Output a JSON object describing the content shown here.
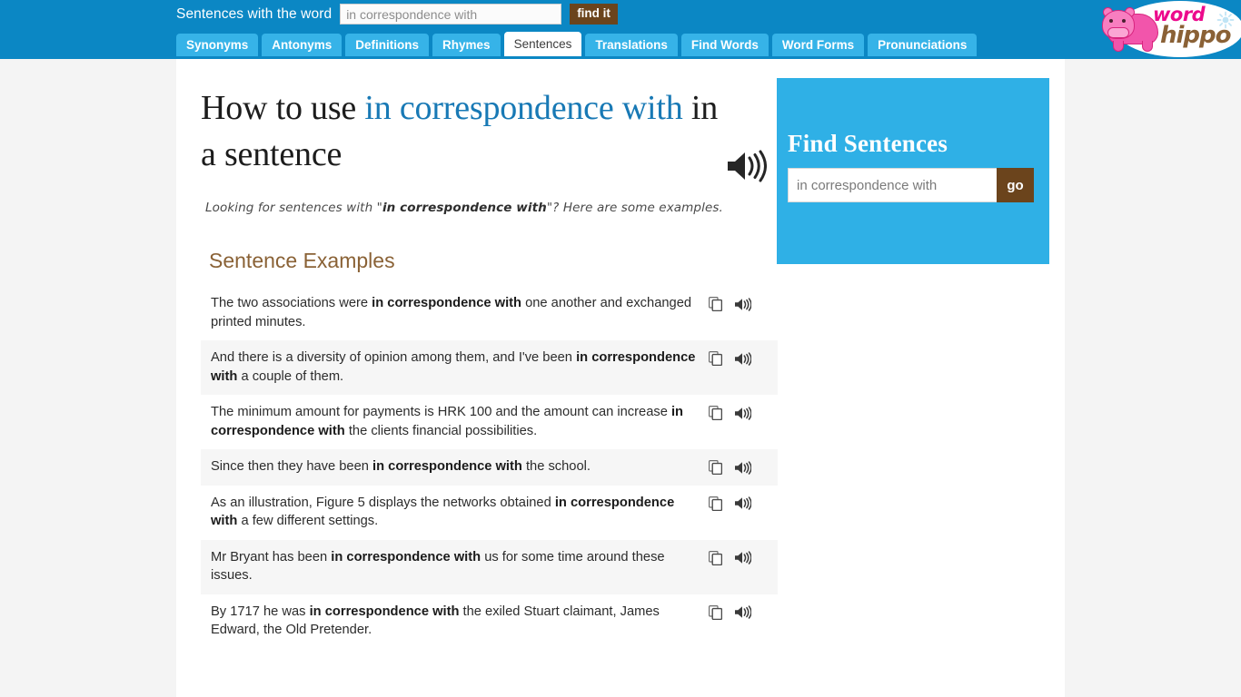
{
  "header": {
    "search_label": "Sentences with the word",
    "word_input_value": "in correspondence with",
    "word_input_placeholder": "in correspondence with",
    "find_button_label": "find it",
    "brightness_icon": "sun-icon",
    "logo": {
      "word": "word",
      "hippo": "hippo"
    },
    "tabs": [
      {
        "label": "Synonyms",
        "active": false
      },
      {
        "label": "Antonyms",
        "active": false
      },
      {
        "label": "Definitions",
        "active": false
      },
      {
        "label": "Rhymes",
        "active": false
      },
      {
        "label": "Sentences",
        "active": true
      },
      {
        "label": "Translations",
        "active": false
      },
      {
        "label": "Find Words",
        "active": false
      },
      {
        "label": "Word Forms",
        "active": false
      },
      {
        "label": "Pronunciations",
        "active": false
      }
    ]
  },
  "main": {
    "heading_prefix": "How to use ",
    "heading_keyword": "in correspondence with",
    "heading_suffix": " in a sentence",
    "heading_speaker_icon": "speaker-icon",
    "subtitle_before": "Looking for sentences with \"",
    "subtitle_keyword": "in correspondence with",
    "subtitle_after": "\"? Here are some examples.",
    "examples_title": "Sentence Examples",
    "row_copy_icon": "copy-icon",
    "row_speaker_icon": "speaker-icon",
    "sentences": [
      {
        "before": "The two associations were ",
        "keyword": "in correspondence with",
        "after": " one another and exchanged printed minutes."
      },
      {
        "before": "And there is a diversity of opinion among them, and I've been ",
        "keyword": "in correspondence with",
        "after": " a couple of them."
      },
      {
        "before": "The minimum amount for payments is HRK 100 and the amount can increase ",
        "keyword": "in correspondence with",
        "after": " the clients financial possibilities."
      },
      {
        "before": "Since then they have been ",
        "keyword": "in correspondence with",
        "after": " the school."
      },
      {
        "before": "As an illustration, Figure 5 displays the networks obtained ",
        "keyword": "in correspondence with",
        "after": " a few different settings."
      },
      {
        "before": "Mr Bryant has been ",
        "keyword": "in correspondence with",
        "after": " us for some time around these issues."
      },
      {
        "before": "By 1717 he was ",
        "keyword": "in correspondence with",
        "after": " the exiled Stuart claimant, James Edward, the Old Pretender."
      }
    ]
  },
  "sidebar": {
    "title": "Find Sentences",
    "input_value": "in correspondence with",
    "input_placeholder": "in correspondence with",
    "go_label": "go"
  },
  "colors": {
    "header_blue": "#0b87c4",
    "tab_blue": "#36b3e8",
    "sidebar_blue": "#2fb0e6",
    "brown": "#6b441c",
    "keyword_blue": "#1879b5",
    "examples_brown": "#8a6236",
    "logo_pink": "#ec0a8c",
    "logo_brown": "#8a6136",
    "row_alt_bg": "#f6f6f6",
    "page_bg": "#f4f4f4"
  }
}
